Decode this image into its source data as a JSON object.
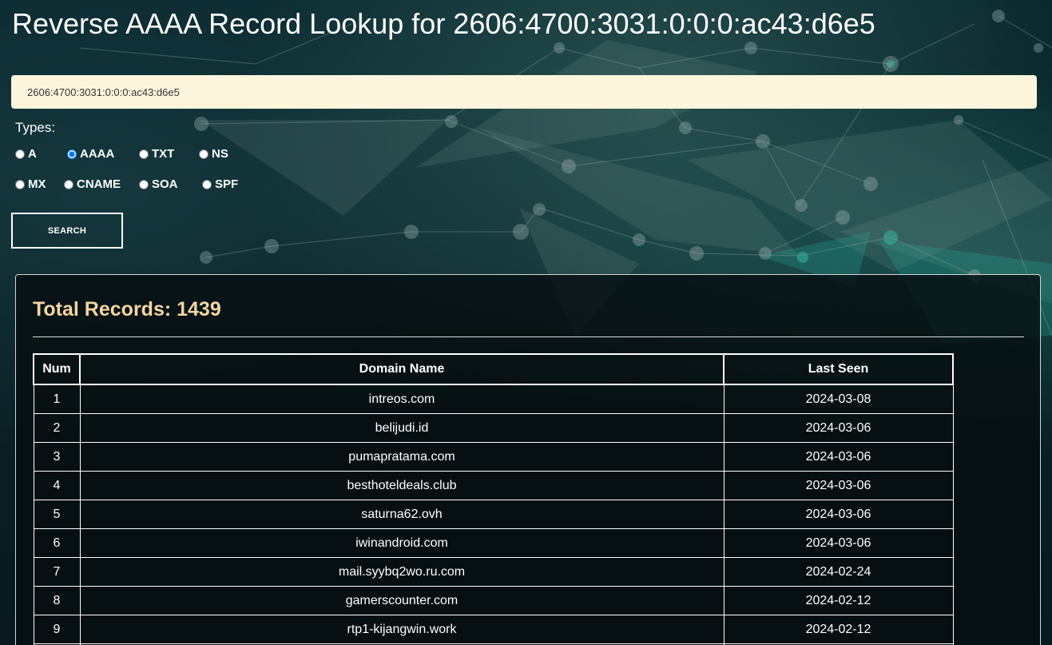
{
  "page": {
    "title": "Reverse AAAA Record Lookup for 2606:4700:3031:0:0:0:ac43:d6e5"
  },
  "search": {
    "value": "2606:4700:3031:0:0:0:ac43:d6e5",
    "button_label": "SEARCH"
  },
  "types": {
    "label": "Types:",
    "selected": "AAAA",
    "options": [
      "A",
      "AAAA",
      "TXT",
      "NS",
      "MX",
      "CNAME",
      "SOA",
      "SPF"
    ]
  },
  "results": {
    "total_label": "Total Records: 1439",
    "columns": [
      "Num",
      "Domain Name",
      "Last Seen"
    ],
    "rows": [
      {
        "num": "1",
        "domain": "intreos.com",
        "last_seen": "2024-03-08"
      },
      {
        "num": "2",
        "domain": "belijudi.id",
        "last_seen": "2024-03-06"
      },
      {
        "num": "3",
        "domain": "pumapratama.com",
        "last_seen": "2024-03-06"
      },
      {
        "num": "4",
        "domain": "besthoteldeals.club",
        "last_seen": "2024-03-06"
      },
      {
        "num": "5",
        "domain": "saturna62.ovh",
        "last_seen": "2024-03-06"
      },
      {
        "num": "6",
        "domain": "iwinandroid.com",
        "last_seen": "2024-03-06"
      },
      {
        "num": "7",
        "domain": "mail.syybq2wo.ru.com",
        "last_seen": "2024-02-24"
      },
      {
        "num": "8",
        "domain": "gamerscounter.com",
        "last_seen": "2024-02-12"
      },
      {
        "num": "9",
        "domain": "rtp1-kijangwin.work",
        "last_seen": "2024-02-12"
      },
      {
        "num": "",
        "domain": "",
        "last_seen": ""
      }
    ]
  },
  "colors": {
    "accent_title": "#f4d6a2",
    "search_bg": "#fdf5dc"
  }
}
